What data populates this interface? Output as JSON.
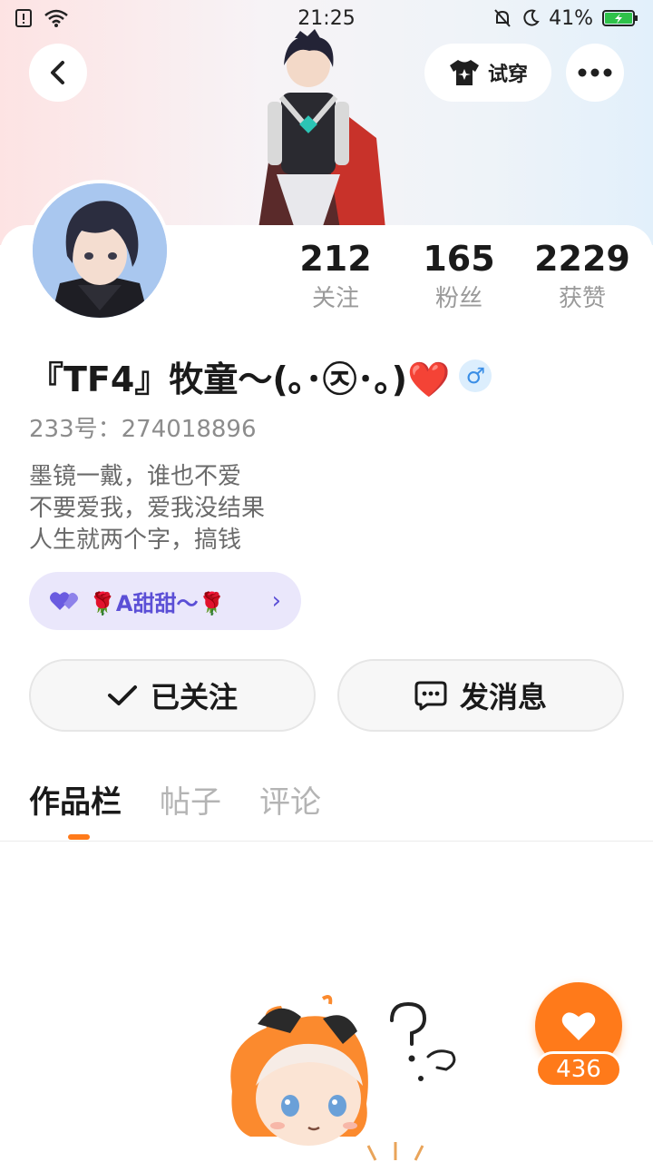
{
  "status_bar": {
    "time": "21:25",
    "battery": "41%",
    "battery_level": 0.41,
    "icons": [
      "notification-alert-icon",
      "wifi-icon",
      "silent-bell-icon",
      "moon-icon",
      "battery-charging-icon"
    ]
  },
  "header": {
    "try_on_label": "试穿",
    "try_on_icon": "tshirt-sparkle-icon",
    "back_icon": "chevron-left-icon",
    "more_icon": "more-dots-icon"
  },
  "profile": {
    "stats": [
      {
        "value": "212",
        "label": "关注"
      },
      {
        "value": "165",
        "label": "粉丝"
      },
      {
        "value": "2229",
        "label": "获赞"
      }
    ],
    "name": "『TF4』牧童～(｡･㉨･｡)❤️",
    "gender_symbol": "♂",
    "uid": "233号：274018896",
    "bio": [
      "墨镜一戴，谁也不爱",
      "不要爱我，爱我没结果",
      "人生就两个字，搞钱"
    ],
    "tag_label": "🌹A甜甜～🌹",
    "tag_icon": "double-heart-icon"
  },
  "actions": {
    "follow_label": "已关注",
    "message_label": "发消息"
  },
  "tabs": [
    "作品栏",
    "帖子",
    "评论"
  ],
  "like": {
    "count": "436"
  },
  "colors": {
    "accent": "#ff7a1a",
    "tag_text": "#5b4fd6",
    "tag_bg": "#eae7fb",
    "gender": "#3a8ee6"
  }
}
